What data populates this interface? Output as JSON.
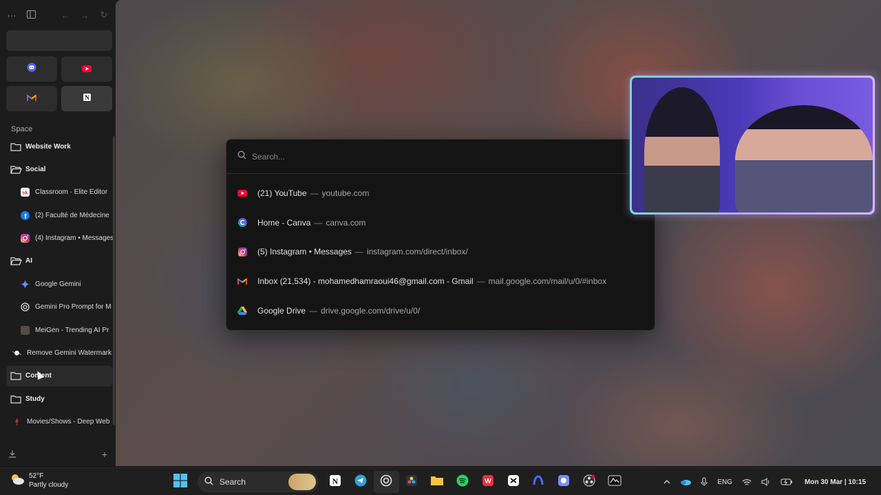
{
  "sidebar": {
    "space_label": "Space",
    "pinned": [
      {
        "icon": "discord-icon"
      },
      {
        "icon": "youtube-icon"
      },
      {
        "icon": "gmail-icon"
      },
      {
        "icon": "notion-icon"
      }
    ],
    "items": [
      {
        "kind": "folder",
        "label": "Website Work",
        "icon": "folder-icon"
      },
      {
        "kind": "folder",
        "label": "Social",
        "icon": "folder-open-icon"
      },
      {
        "kind": "tab",
        "label": "Classroom · Elite Editor",
        "icon": "skool-icon"
      },
      {
        "kind": "tab",
        "label": "(2) Faculté de Médecine",
        "icon": "facebook-icon"
      },
      {
        "kind": "tab",
        "label": "(4) Instagram • Messages",
        "icon": "instagram-icon"
      },
      {
        "kind": "folder",
        "label": "AI",
        "icon": "folder-open-icon"
      },
      {
        "kind": "tab",
        "label": "Google Gemini",
        "icon": "gemini-icon"
      },
      {
        "kind": "tab",
        "label": "Gemini Pro Prompt for M",
        "icon": "chatgpt-icon"
      },
      {
        "kind": "tab",
        "label": "MeiGen - Trending AI Pr",
        "icon": "meigen-icon"
      },
      {
        "kind": "toptab",
        "label": "Remove Gemini Watermark",
        "icon": "sparkle-icon"
      },
      {
        "kind": "folder",
        "label": "Content",
        "icon": "folder-icon"
      },
      {
        "kind": "folder",
        "label": "Study",
        "icon": "folder-icon"
      },
      {
        "kind": "toptab",
        "label": "Movies/Shows - Deep Web",
        "icon": "film-icon"
      }
    ]
  },
  "palette": {
    "placeholder": "Search...",
    "separator": "—",
    "results": [
      {
        "title": "(21) YouTube",
        "url": "youtube.com",
        "icon": "youtube-icon"
      },
      {
        "title": "Home - Canva",
        "url": "canva.com",
        "icon": "canva-icon"
      },
      {
        "title": "(5) Instagram • Messages",
        "url": "instagram.com/direct/inbox/",
        "icon": "instagram-icon"
      },
      {
        "title": "Inbox (21,534) - mohamedhamraoui46@gmail.com - Gmail",
        "url": "mail.google.com/mail/u/0/#inbox",
        "icon": "gmail-icon"
      },
      {
        "title": "Google Drive",
        "url": "drive.google.com/drive/u/0/",
        "icon": "google-drive-icon"
      }
    ]
  },
  "taskbar": {
    "weather_temp": "52°F",
    "weather_desc": "Partly cloudy",
    "search_label": "Search",
    "language": "ENG",
    "clock": "Mon 30 Mar | 10:15"
  },
  "colors": {
    "youtube": "#ff0033",
    "gmail_red": "#ea4335",
    "accent_webcam_border": "#b5a8ff"
  }
}
